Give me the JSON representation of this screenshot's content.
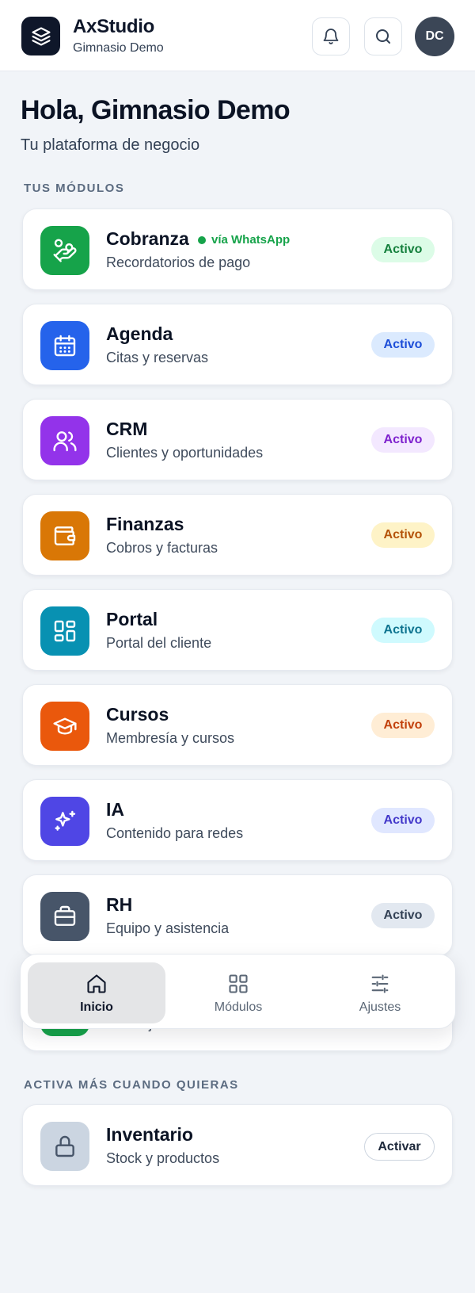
{
  "header": {
    "app_title": "AxStudio",
    "business_name": "Gimnasio Demo",
    "avatar_initials": "DC"
  },
  "hero": {
    "greeting": "Hola, Gimnasio Demo",
    "tagline": "Tu plataforma de negocio"
  },
  "sections": {
    "my_modules": "TUS MÓDULOS",
    "activate_more": "ACTIVA MÁS CUANDO QUIERAS"
  },
  "modules": [
    {
      "name": "Cobranza",
      "tag": "vía WhatsApp",
      "desc": "Recordatorios de pago",
      "status": "Activo",
      "icon": "hand-coins-icon",
      "color": "#16a34a",
      "badge_bg": "#dcfce7",
      "badge_fg": "#15803d"
    },
    {
      "name": "Agenda",
      "desc": "Citas y reservas",
      "status": "Activo",
      "icon": "calendar-icon",
      "color": "#2563eb",
      "badge_bg": "#dbeafe",
      "badge_fg": "#1d4ed8"
    },
    {
      "name": "CRM",
      "desc": "Clientes y oportunidades",
      "status": "Activo",
      "icon": "users-icon",
      "color": "#9333ea",
      "badge_bg": "#f3e8ff",
      "badge_fg": "#7e22ce"
    },
    {
      "name": "Finanzas",
      "desc": "Cobros y facturas",
      "status": "Activo",
      "icon": "wallet-icon",
      "color": "#d97706",
      "badge_bg": "#fef3c7",
      "badge_fg": "#b45309"
    },
    {
      "name": "Portal",
      "desc": "Portal del cliente",
      "status": "Activo",
      "icon": "layout-dashboard-icon",
      "color": "#0891b2",
      "badge_bg": "#cffafe",
      "badge_fg": "#0e7490"
    },
    {
      "name": "Cursos",
      "desc": "Membresía y cursos",
      "status": "Activo",
      "icon": "graduation-cap-icon",
      "color": "#ea580c",
      "badge_bg": "#ffedd5",
      "badge_fg": "#c2410c"
    },
    {
      "name": "IA",
      "desc": "Contenido para redes",
      "status": "Activo",
      "icon": "sparkles-icon",
      "color": "#4f46e5",
      "badge_bg": "#e0e7ff",
      "badge_fg": "#4338ca"
    },
    {
      "name": "RH",
      "desc": "Equipo y asistencia",
      "status": "Activo",
      "icon": "briefcase-icon",
      "color": "#475569",
      "badge_bg": "#e2e8f0",
      "badge_fg": "#334155"
    },
    {
      "name": "",
      "desc": "Mensajes de clientes",
      "status": "",
      "icon": "chat-icon",
      "color": "#16a34a",
      "badge_bg": "#dcfce7",
      "badge_fg": "#15803d"
    }
  ],
  "available_modules": [
    {
      "name": "Inventario",
      "desc": "Stock y productos",
      "action": "Activar",
      "icon": "lock-icon",
      "color": "#cbd5e1"
    }
  ],
  "bottom_nav": [
    {
      "label": "Inicio",
      "icon": "home-icon",
      "active": true
    },
    {
      "label": "Módulos",
      "icon": "grid-icon",
      "active": false
    },
    {
      "label": "Ajustes",
      "icon": "sliders-icon",
      "active": false
    }
  ]
}
